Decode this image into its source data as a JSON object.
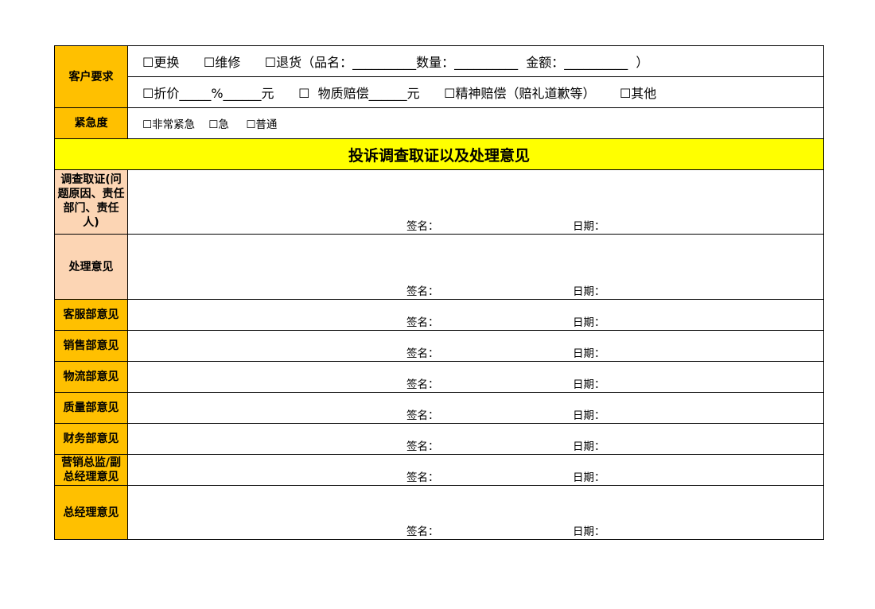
{
  "customer_request": {
    "label": "客户要求",
    "line1": "☐更换      ☐维修      ☐退货（品名：__________数量：__________  金额：__________  ）",
    "line2": "☐折价_____%______元      ☐  物质赔偿______元      ☐精神赔偿（赔礼道歉等）      ☐其他"
  },
  "urgency": {
    "label": "紧急度",
    "line": "☐非常紧急    ☐急     ☐普通"
  },
  "section_title": "投诉调查取证以及处理意见",
  "signature_label": "签名：",
  "date_label": "日期：",
  "rows": [
    {
      "label": "调查取证(问题原因、责任部门、责任人)"
    },
    {
      "label": "处理意见"
    },
    {
      "label": "客服部意见"
    },
    {
      "label": "销售部意见"
    },
    {
      "label": "物流部意见"
    },
    {
      "label": "质量部意见"
    },
    {
      "label": "财务部意见"
    },
    {
      "label": "营销总监/副总经理意见"
    },
    {
      "label": "总经理意见"
    }
  ]
}
